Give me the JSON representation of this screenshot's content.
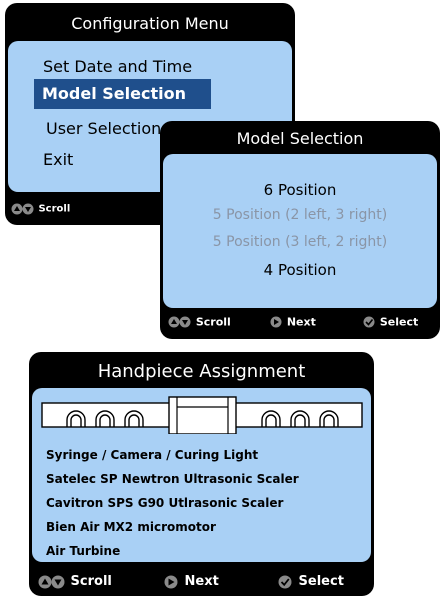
{
  "config_menu": {
    "title": "Configuration Menu",
    "items": [
      "Set Date and Time",
      "Model Selection",
      "User Selection",
      "Exit"
    ],
    "selected_index": 1,
    "footer": {
      "scroll": "Scroll"
    }
  },
  "model_selection": {
    "title": "Model Selection",
    "options": [
      {
        "label": "6 Position",
        "enabled": true
      },
      {
        "label": "5 Position (2 left, 3 right)",
        "enabled": false
      },
      {
        "label": "5 Position (3 left, 2 right)",
        "enabled": false
      },
      {
        "label": "4 Position",
        "enabled": true
      }
    ],
    "footer": {
      "scroll": "Scroll",
      "next": "Next",
      "select": "Select"
    }
  },
  "handpiece_assignment": {
    "title": "Handpiece Assignment",
    "handpieces": [
      "Syringe / Camera / Curing Light",
      "Satelec SP Newtron Ultrasonic Scaler",
      "Cavitron SPS G90 Utlrasonic Scaler",
      "Bien Air MX2 micromotor",
      "Air Turbine"
    ],
    "footer": {
      "scroll": "Scroll",
      "next": "Next",
      "select": "Select"
    }
  },
  "colors": {
    "screen_bg": "#a9d0f5",
    "highlight": "#1f4f8c",
    "disabled_text": "#8a95a6",
    "frame": "#000000"
  },
  "icons": {
    "scroll": "up-down-arrows-icon",
    "next": "right-arrow-icon",
    "select": "checkmark-icon"
  }
}
